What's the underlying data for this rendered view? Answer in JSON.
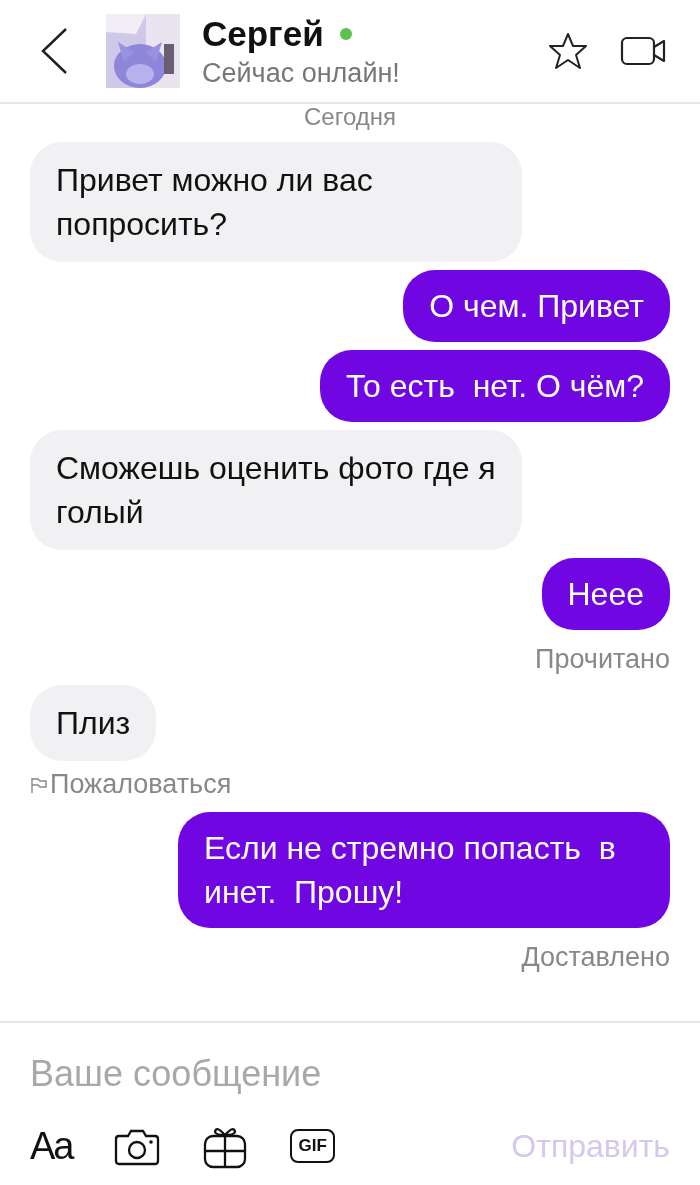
{
  "header": {
    "name": "Сергей",
    "online": true,
    "status": "Сейчас онлайн!"
  },
  "date_label": "Сегодня",
  "messages": [
    {
      "kind": "in",
      "text": "Привет можно ли вас попросить?"
    },
    {
      "kind": "out",
      "text": "О чем. Привет"
    },
    {
      "kind": "out",
      "text": "То есть  нет. О чём?"
    },
    {
      "kind": "in",
      "text": "Сможешь оценить фото где я голый"
    },
    {
      "kind": "out",
      "text": "Неее",
      "status": "Прочитано"
    },
    {
      "kind": "in",
      "text": "Плиз",
      "report": "Пожаловаться"
    },
    {
      "kind": "out",
      "text": "Если не стремно попасть  в инет.  Прошу!",
      "status": "Доставлено"
    }
  ],
  "composer": {
    "placeholder": "Ваше сообщение",
    "font_key": "Aa",
    "gif_key": "GIF",
    "send": {
      "label": "Отправить",
      "disabled": true
    }
  }
}
